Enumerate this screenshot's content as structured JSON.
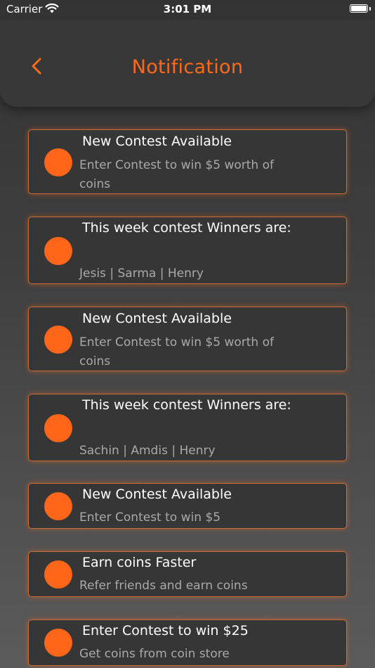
{
  "status_bar": {
    "carrier": "Carrier",
    "time": "3:01 PM"
  },
  "header": {
    "title": "Notification"
  },
  "notifications": [
    {
      "title": "New Contest Available",
      "subtitle": "Enter Contest to win $5 worth of coins"
    },
    {
      "title": "This week contest Winners are:",
      "subtitle": "Jesis | Sarma | Henry"
    },
    {
      "title": "New Contest Available",
      "subtitle": "Enter Contest to win $5 worth of coins"
    },
    {
      "title": "This week contest Winners are:",
      "subtitle": "Sachin | Amdis | Henry"
    },
    {
      "title": "New Contest Available",
      "subtitle": "Enter Contest to win $5"
    },
    {
      "title": "Earn coins Faster",
      "subtitle": "Refer friends and earn coins"
    },
    {
      "title": "Enter Contest to win $25",
      "subtitle": "Get coins from coin store"
    }
  ],
  "colors": {
    "accent": "#ff6a1a",
    "card": "#363636",
    "border": "#c96b35"
  }
}
